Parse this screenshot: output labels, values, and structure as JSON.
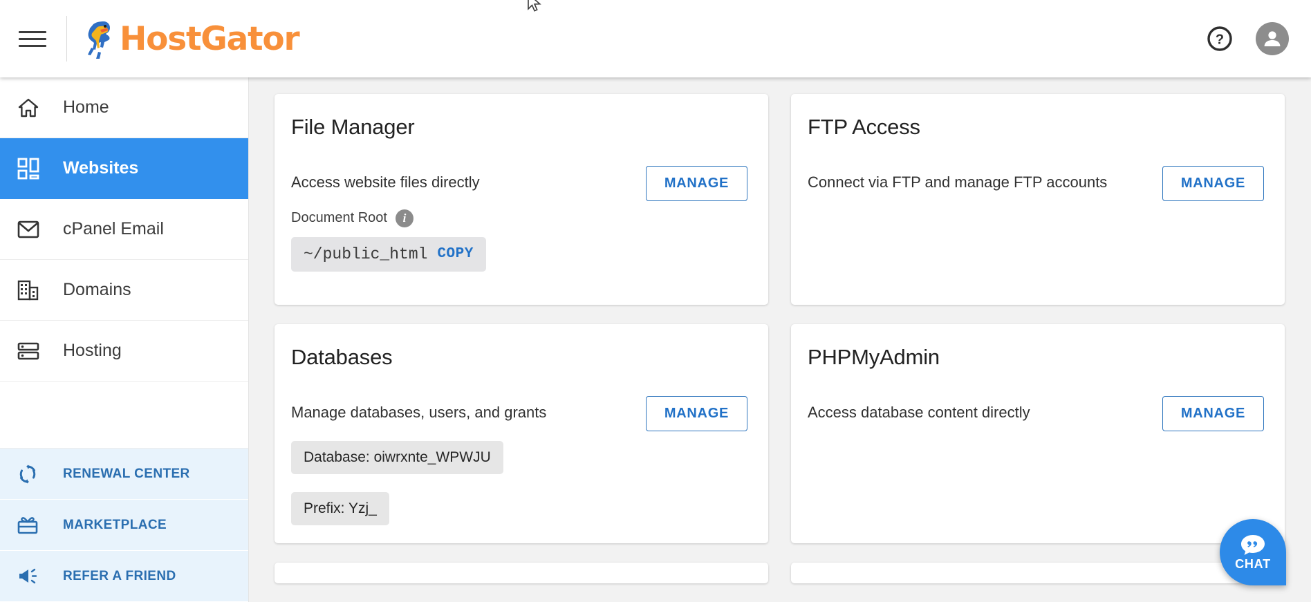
{
  "brand": {
    "name": "HostGator",
    "accent_orange": "#f8903a",
    "accent_blue": "#3290ed"
  },
  "header": {
    "menu_icon": "hamburger-menu-icon",
    "logo_icon": "hostgator-alligator-logo",
    "help_icon": "help-question-circle-icon",
    "avatar_icon": "user-avatar-icon"
  },
  "sidebar": {
    "items": [
      {
        "label": "Home",
        "icon": "home-icon",
        "active": false
      },
      {
        "label": "Websites",
        "icon": "websites-grid-icon",
        "active": true
      },
      {
        "label": "cPanel Email",
        "icon": "email-envelope-icon",
        "active": false
      },
      {
        "label": "Domains",
        "icon": "domains-building-icon",
        "active": false
      },
      {
        "label": "Hosting",
        "icon": "hosting-server-icon",
        "active": false
      }
    ],
    "promos": [
      {
        "label": "RENEWAL CENTER",
        "icon": "refresh-cycle-icon"
      },
      {
        "label": "MARKETPLACE",
        "icon": "gift-ticket-icon"
      },
      {
        "label": "REFER A FRIEND",
        "icon": "megaphone-icon"
      }
    ]
  },
  "cards": {
    "file_manager": {
      "title": "File Manager",
      "description": "Access website files directly",
      "button": "MANAGE",
      "doc_root_label": "Document Root",
      "doc_root_path": "~/public_html",
      "copy_label": "COPY"
    },
    "ftp_access": {
      "title": "FTP Access",
      "description": "Connect via FTP and manage FTP accounts",
      "button": "MANAGE"
    },
    "databases": {
      "title": "Databases",
      "description": "Manage databases, users, and grants",
      "button": "MANAGE",
      "database_chip": "Database: oiwrxnte_WPWJU",
      "prefix_chip": "Prefix: Yzj_"
    },
    "phpmyadmin": {
      "title": "PHPMyAdmin",
      "description": "Access database content directly",
      "button": "MANAGE"
    }
  },
  "chat": {
    "label": "CHAT",
    "icon": "chat-bubble-icon",
    "color": "#2d8ae8"
  }
}
